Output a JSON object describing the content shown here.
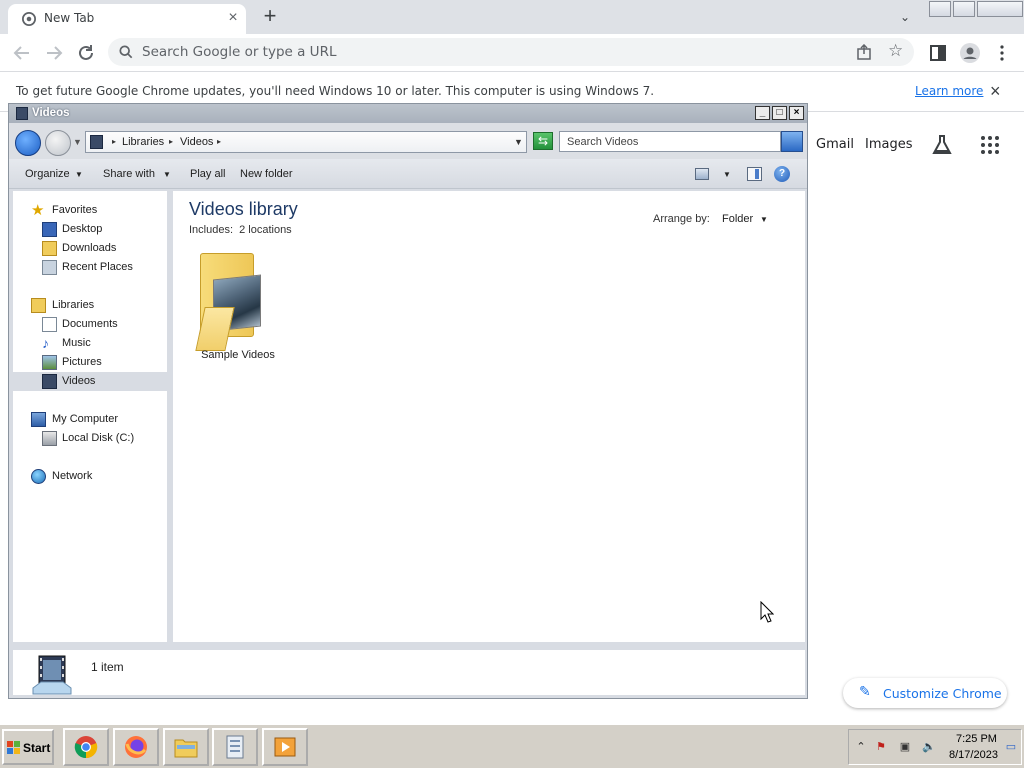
{
  "chrome": {
    "tab_title": "New Tab",
    "omnibox_placeholder": "Search Google or type a URL",
    "infobar_text": "To get future Google Chrome updates, you'll need Windows 10 or later. This computer is using Windows 7.",
    "infobar_link": "Learn more",
    "ntp_links": [
      "Gmail",
      "Images"
    ],
    "customize_label": "Customize Chrome"
  },
  "explorer": {
    "title": "Videos",
    "breadcrumb": [
      "Libraries",
      "Videos"
    ],
    "search_placeholder": "Search Videos",
    "commands": {
      "organize": "Organize",
      "share_with": "Share with",
      "play_all": "Play all",
      "new_folder": "New folder"
    },
    "nav": {
      "favorites": "Favorites",
      "desktop": "Desktop",
      "downloads": "Downloads",
      "recent_places": "Recent Places",
      "libraries": "Libraries",
      "documents": "Documents",
      "music": "Music",
      "pictures": "Pictures",
      "videos": "Videos",
      "my_computer": "My Computer",
      "local_disk": "Local Disk (C:)",
      "network": "Network"
    },
    "library_title": "Videos library",
    "includes_label": "Includes:",
    "includes_value": "2 locations",
    "arrange_by_label": "Arrange by:",
    "arrange_by_value": "Folder",
    "items": [
      {
        "label": "Sample Videos",
        "icon": "folder-icon"
      }
    ],
    "status": "1 item"
  },
  "taskbar": {
    "start_label": "Start",
    "time": "7:25 PM",
    "date": "8/17/2023"
  },
  "colors": {
    "chrome_blue": "#1a73e8",
    "explorer_title": "#1e3a66"
  }
}
